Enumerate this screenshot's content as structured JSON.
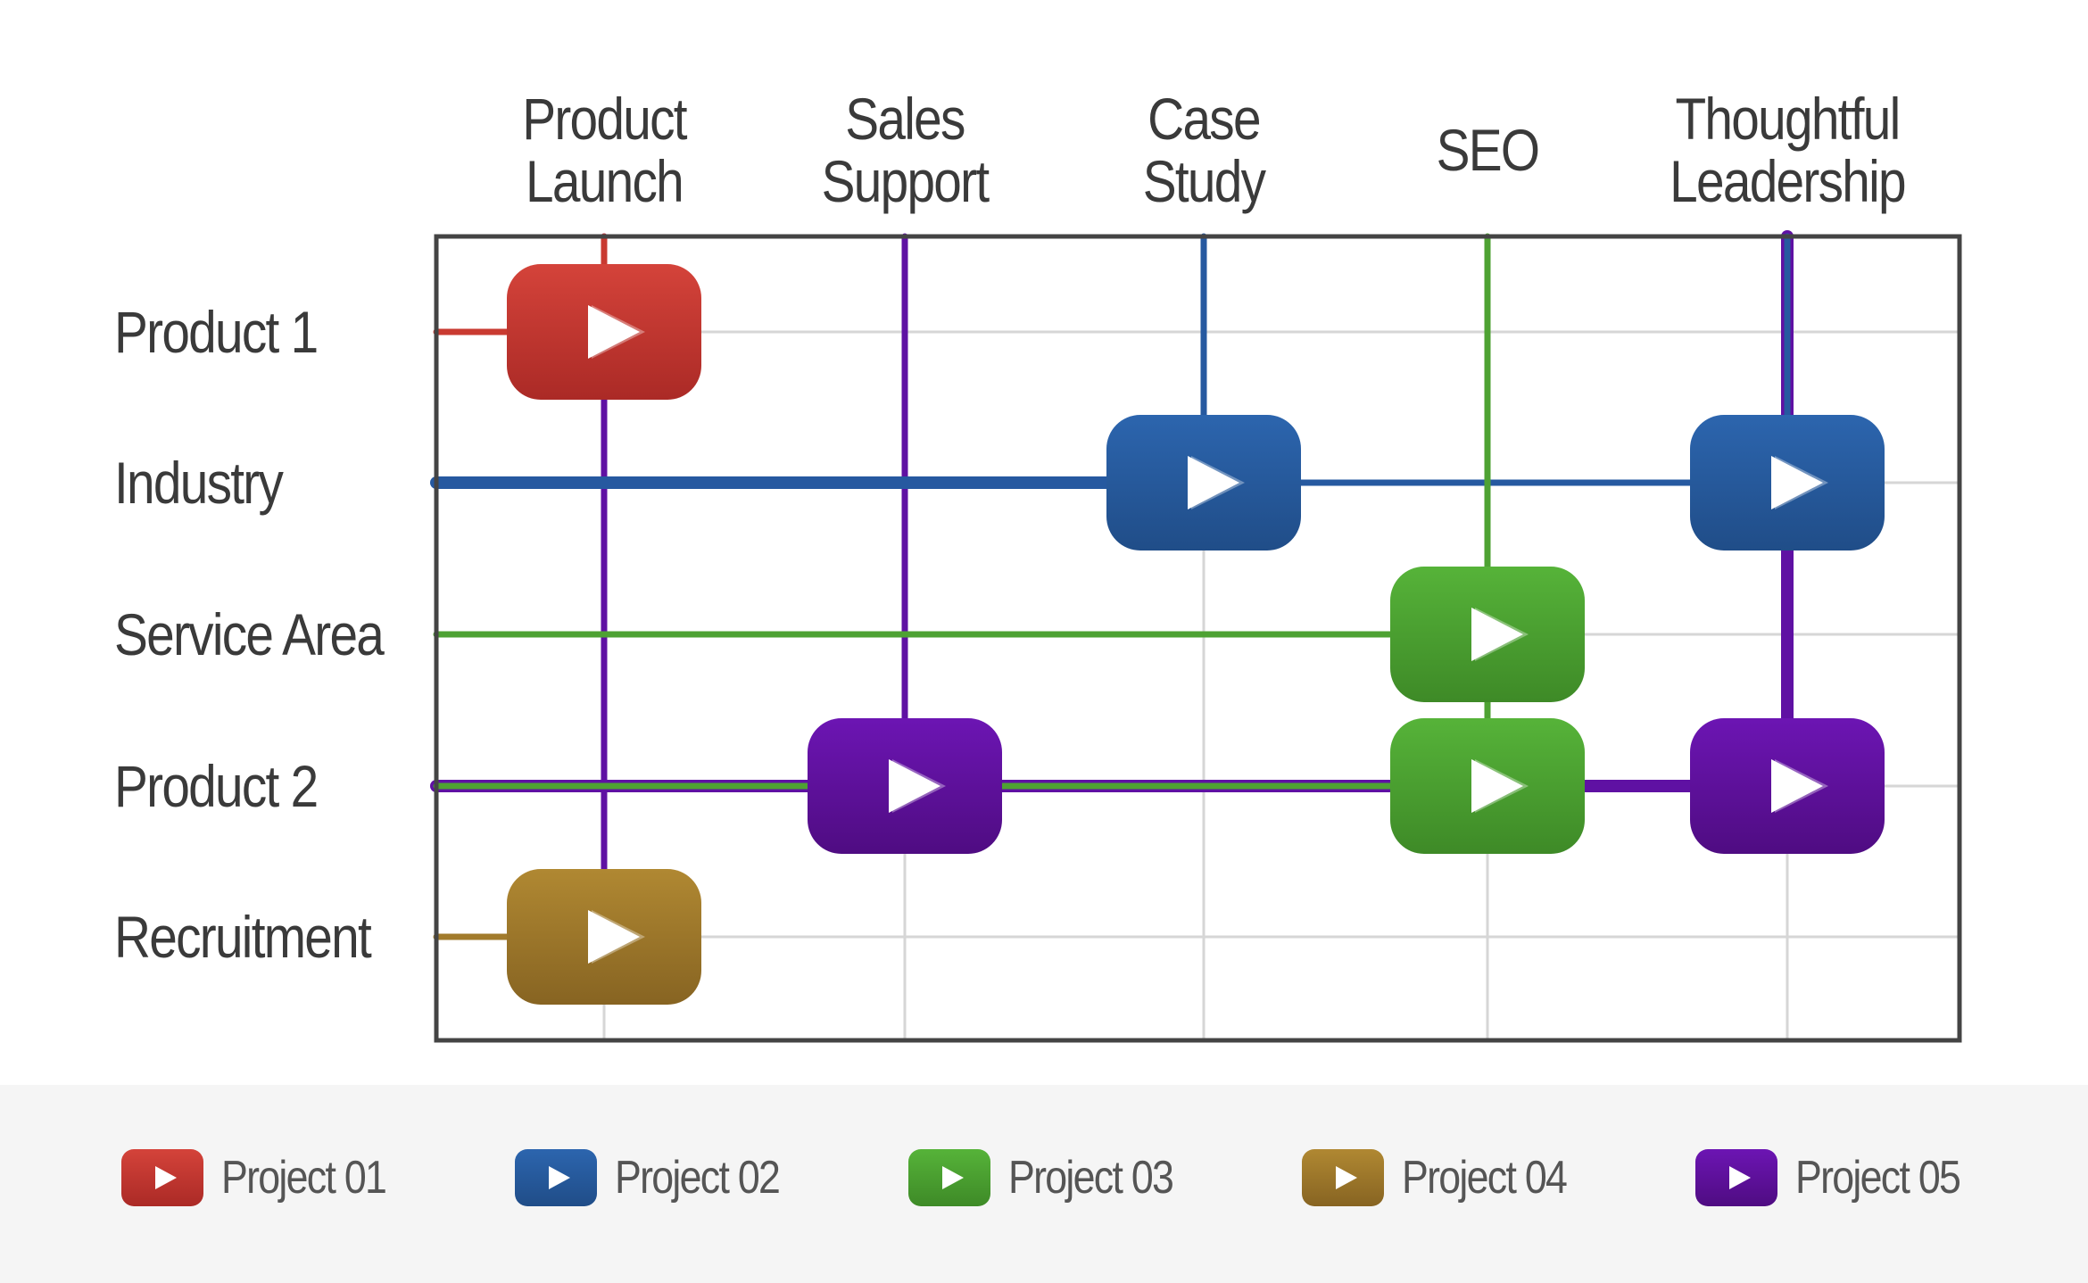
{
  "chart_data": {
    "type": "matrix",
    "columns": [
      {
        "label_lines": [
          "Product",
          "Launch"
        ]
      },
      {
        "label_lines": [
          "Sales",
          "Support"
        ]
      },
      {
        "label_lines": [
          "Case",
          "Study"
        ]
      },
      {
        "label_lines": [
          "SEO"
        ]
      },
      {
        "label_lines": [
          "Thoughtful",
          "Leadership"
        ]
      }
    ],
    "rows": [
      "Product 1",
      "Industry",
      "Service Area",
      "Product 2",
      "Recruitment"
    ],
    "projects": [
      {
        "name": "Project 01",
        "color": "#c93a31",
        "color_top": "#d4433a",
        "color_bottom": "#ab2a26",
        "placements": [
          {
            "row": 0,
            "col": 0
          }
        ]
      },
      {
        "name": "Project 02",
        "color": "#2659a0",
        "color_top": "#2c65ae",
        "color_bottom": "#204d88",
        "placements": [
          {
            "row": 1,
            "col": 2
          },
          {
            "row": 1,
            "col": 4
          }
        ]
      },
      {
        "name": "Project 03",
        "color": "#4ea233",
        "color_top": "#56b339",
        "color_bottom": "#3e8a27",
        "placements": [
          {
            "row": 2,
            "col": 3
          },
          {
            "row": 3,
            "col": 3
          }
        ]
      },
      {
        "name": "Project 04",
        "color": "#a27b2c",
        "color_top": "#b08832",
        "color_bottom": "#876422",
        "placements": [
          {
            "row": 4,
            "col": 0
          }
        ]
      },
      {
        "name": "Project 05",
        "color": "#5f11a3",
        "color_top": "#6c15b3",
        "color_bottom": "#4f0c82",
        "placements": [
          {
            "row": 3,
            "col": 1
          },
          {
            "row": 3,
            "col": 4
          }
        ]
      }
    ],
    "connectors": [
      {
        "project": 4,
        "dir": "v",
        "col": 0,
        "from_row": "top",
        "to_row": 4
      },
      {
        "project": 0,
        "dir": "v",
        "col": 0,
        "from_row": "top",
        "to_row": 0
      },
      {
        "project": 0,
        "dir": "h",
        "row": 0,
        "from_col": "left",
        "to_col": 0
      },
      {
        "project": 3,
        "dir": "h",
        "row": 4,
        "from_col": "left",
        "to_col": 0
      },
      {
        "project": 4,
        "dir": "v",
        "col": 1,
        "from_row": "top",
        "to_row": 3
      },
      {
        "project": 4,
        "dir": "h",
        "row": 3,
        "from_col": "left",
        "to_col": 4,
        "wide": true
      },
      {
        "project": 2,
        "dir": "h",
        "row": 3,
        "from_col": "left",
        "to_col": 3
      },
      {
        "project": 1,
        "dir": "v",
        "col": 2,
        "from_row": "top",
        "to_row": 1
      },
      {
        "project": 1,
        "dir": "h",
        "row": 1,
        "from_col": "left",
        "to_col": 2,
        "wide": true
      },
      {
        "project": 1,
        "dir": "h",
        "row": 1,
        "from_col": 2,
        "to_col": 4
      },
      {
        "project": 2,
        "dir": "v",
        "col": 3,
        "from_row": "top",
        "to_row": 3
      },
      {
        "project": 2,
        "dir": "h",
        "row": 2,
        "from_col": "left",
        "to_col": 3
      },
      {
        "project": 4,
        "dir": "v",
        "col": 4,
        "from_row": "top",
        "to_row": 3,
        "wide": true
      },
      {
        "project": 1,
        "dir": "v",
        "col": 4,
        "from_row": "top",
        "to_row": 1
      }
    ],
    "grid": true
  },
  "legend": {
    "items": [
      {
        "label": "Project 01"
      },
      {
        "label": "Project 02"
      },
      {
        "label": "Project 03"
      },
      {
        "label": "Project 04"
      },
      {
        "label": "Project 05"
      }
    ]
  }
}
